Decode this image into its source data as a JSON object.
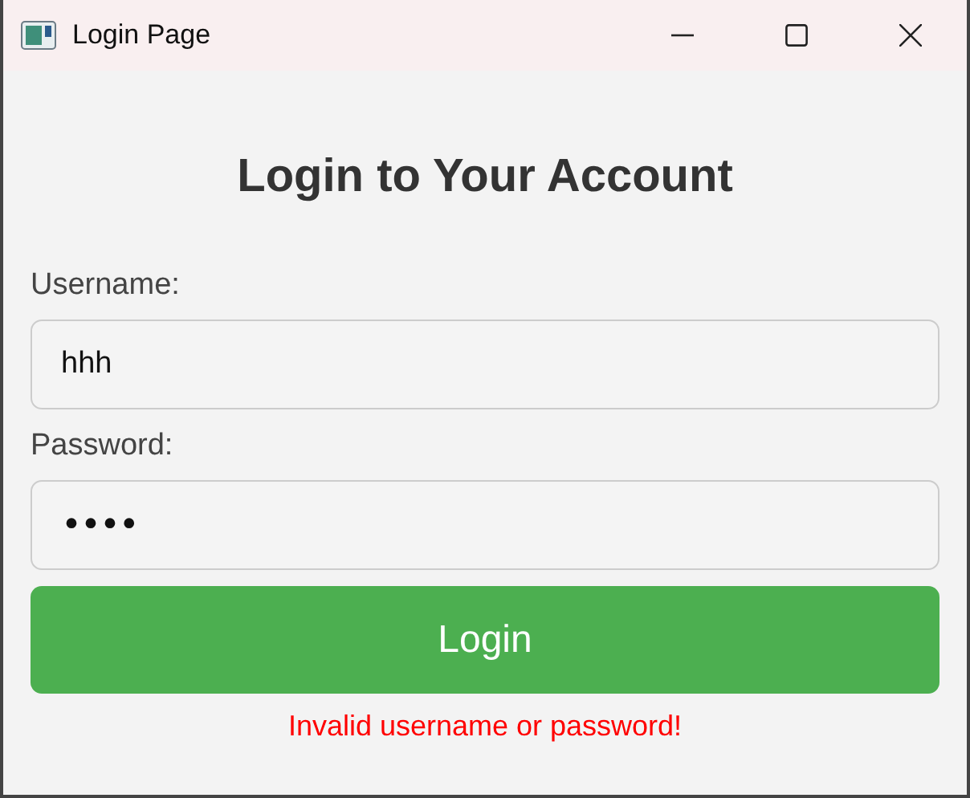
{
  "window": {
    "title": "Login Page"
  },
  "heading": "Login to Your Account",
  "fields": [
    {
      "label": "Username:",
      "value": "hhh",
      "kind": "text"
    },
    {
      "label": "Password:",
      "value": "••••",
      "kind": "password"
    }
  ],
  "login_button": "Login",
  "error_message": "Invalid username or password!"
}
